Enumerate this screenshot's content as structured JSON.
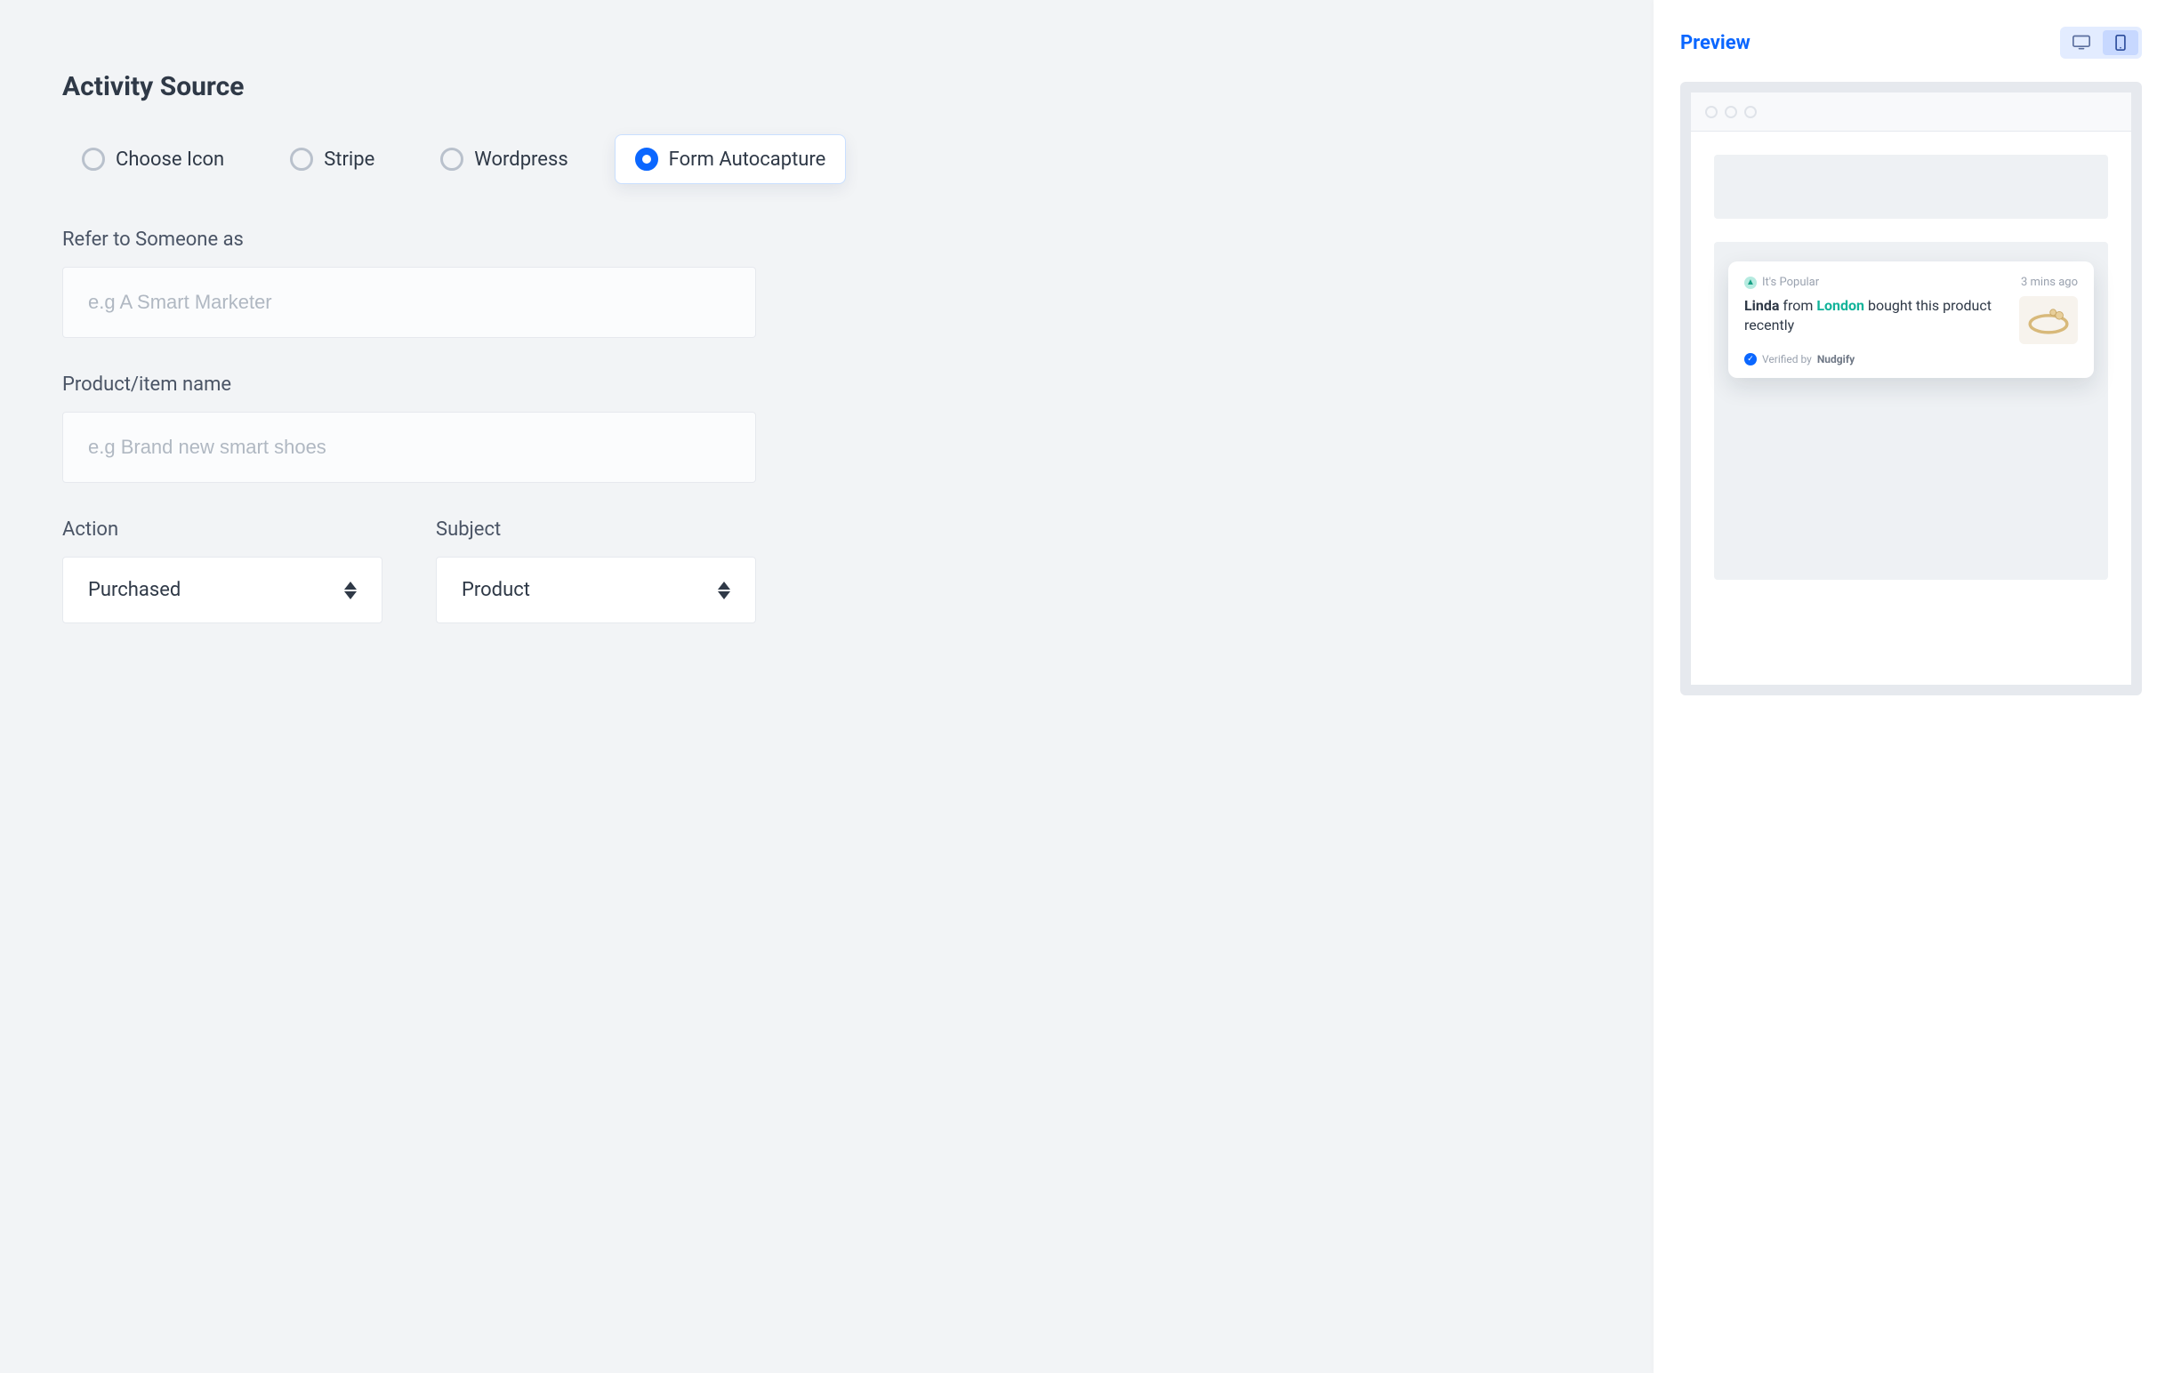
{
  "left": {
    "title": "Activity Source",
    "sources": [
      {
        "label": "Choose Icon",
        "selected": false
      },
      {
        "label": "Stripe",
        "selected": false
      },
      {
        "label": "Wordpress",
        "selected": false
      },
      {
        "label": "Form Autocapture",
        "selected": true
      }
    ],
    "refer": {
      "label": "Refer to Someone as",
      "placeholder": "e.g A Smart Marketer",
      "value": ""
    },
    "product": {
      "label": "Product/item name",
      "placeholder": "e.g Brand new smart shoes",
      "value": ""
    },
    "action": {
      "label": "Action",
      "value": "Purchased"
    },
    "subject": {
      "label": "Subject",
      "value": "Product"
    }
  },
  "preview": {
    "title": "Preview",
    "device": "mobile",
    "nudge": {
      "tag": "It's Popular",
      "time": "3 mins ago",
      "name": "Linda",
      "from_word": "from",
      "city": "London",
      "tail": "bought this product recently",
      "verified_prefix": "Verified by",
      "verified_brand": "Nudgify"
    }
  }
}
